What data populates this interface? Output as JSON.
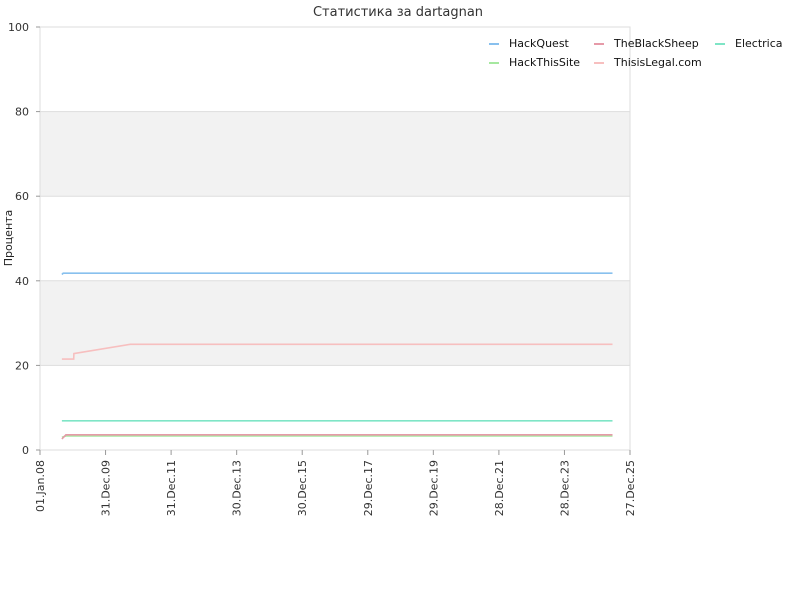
{
  "chart_data": {
    "type": "line",
    "title": "Статистика за dartagnan",
    "xlabel": "",
    "ylabel": "Процента",
    "ylim": [
      0,
      100
    ],
    "y_ticks": [
      0,
      20,
      40,
      60,
      80,
      100
    ],
    "x_ticks": [
      "01.Jan.08",
      "31.Dec.09",
      "31.Dec.11",
      "30.Dec.13",
      "30.Dec.15",
      "29.Dec.17",
      "29.Dec.19",
      "28.Dec.21",
      "28.Dec.23",
      "27.Dec.25"
    ],
    "x_range": [
      "2008-01-01",
      "2025-12-27"
    ],
    "grid": "horizontal bands",
    "legend_position": "top-right",
    "series": [
      {
        "name": "HackQuest",
        "color": "#88c0ee",
        "points": [
          [
            "2008-09-01",
            41.5
          ],
          [
            "2008-09-15",
            41.8
          ],
          [
            "2025-06-15",
            41.8
          ]
        ]
      },
      {
        "name": "HackThisSite",
        "color": "#a6e8a0",
        "points": [
          [
            "2008-09-01",
            3.0
          ],
          [
            "2008-10-15",
            3.3
          ],
          [
            "2025-06-15",
            3.3
          ]
        ]
      },
      {
        "name": "TheBlackSheep",
        "color": "#e69aa8",
        "points": [
          [
            "2008-09-01",
            2.6
          ],
          [
            "2008-10-15",
            3.6
          ],
          [
            "2025-06-15",
            3.6
          ]
        ]
      },
      {
        "name": "ThisisLegal.com",
        "color": "#f7bfbf",
        "points": [
          [
            "2008-09-01",
            21.5
          ],
          [
            "2009-01-10",
            21.5
          ],
          [
            "2009-01-12",
            22.8
          ],
          [
            "2010-10-01",
            25.0
          ],
          [
            "2025-06-15",
            25.0
          ]
        ]
      },
      {
        "name": "Electrica",
        "color": "#7fe5c6",
        "points": [
          [
            "2008-09-01",
            6.9
          ],
          [
            "2025-06-15",
            6.9
          ]
        ]
      }
    ]
  }
}
